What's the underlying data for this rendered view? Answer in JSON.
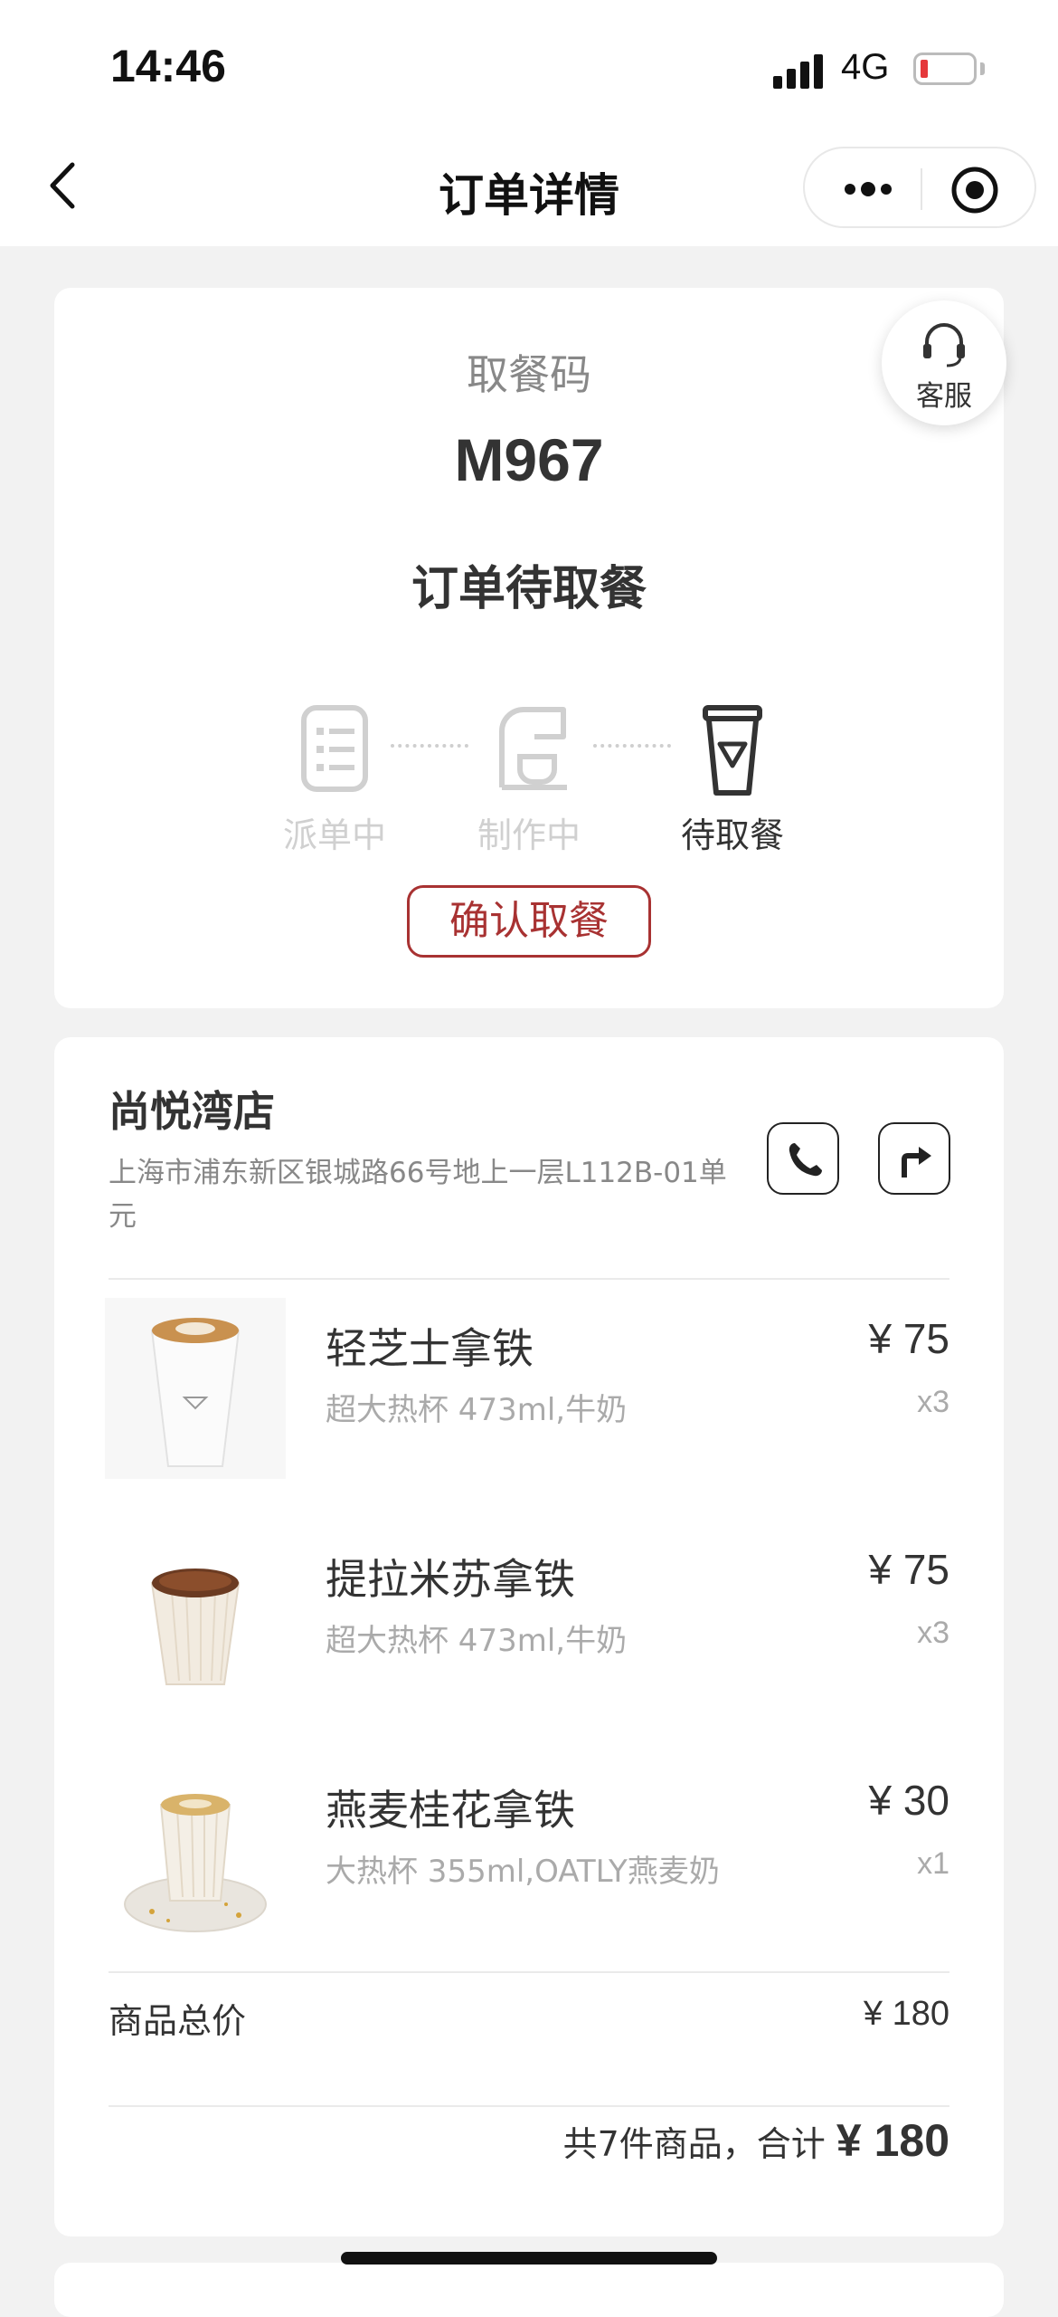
{
  "status_bar": {
    "time": "14:46",
    "network": "4G",
    "battery_level": 0.1
  },
  "nav": {
    "title": "订单详情",
    "back_icon": "chevron-left-icon",
    "more_icon": "more-dots-icon",
    "close_icon": "target-icon"
  },
  "pickup": {
    "customer_service_label": "客服",
    "code_label": "取餐码",
    "code": "M967",
    "order_state": "订单待取餐",
    "steps": [
      {
        "label": "派单中",
        "icon": "list-icon",
        "active": false
      },
      {
        "label": "制作中",
        "icon": "coffee-machine-icon",
        "active": false
      },
      {
        "label": "待取餐",
        "icon": "cup-icon",
        "active": true
      }
    ],
    "confirm_label": "确认取餐",
    "colors": {
      "accent": "#a83232",
      "inactive": "#d0d0d0"
    }
  },
  "store": {
    "name": "尚悦湾店",
    "address": "上海市浦东新区银城路66号地上一层L112B-01单元",
    "phone_icon": "phone-icon",
    "navigate_icon": "navigate-icon"
  },
  "items": [
    {
      "name": "轻芝士拿铁",
      "spec": "超大热杯 473ml,牛奶",
      "price": "¥ 75",
      "qty": "x3",
      "image": "white-cup-latte"
    },
    {
      "name": "提拉米苏拿铁",
      "spec": "超大热杯 473ml,牛奶",
      "price": "¥ 75",
      "qty": "x3",
      "image": "tiramisu-cup"
    },
    {
      "name": "燕麦桂花拿铁",
      "spec": "大热杯 355ml,OATLY燕麦奶",
      "price": "¥ 30",
      "qty": "x1",
      "image": "osmanthus-cup-saucer"
    }
  ],
  "summary": {
    "subtotal_label": "商品总价",
    "subtotal_value": "¥ 180",
    "total_prefix": "共7件商品，合计 ",
    "total_amount": "¥ 180"
  }
}
